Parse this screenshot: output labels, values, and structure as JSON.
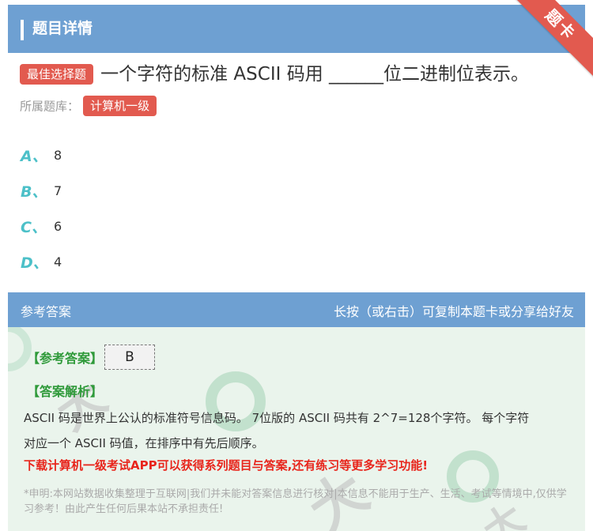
{
  "header": {
    "title": "题目详情",
    "ribbon_text": "题卡"
  },
  "question": {
    "type_tag": "最佳选择题",
    "text": "一个字符的标准 ASCII 码用 ______位二进制位表示。"
  },
  "bank": {
    "label": "所属题库：",
    "name": "计算机一级"
  },
  "options": [
    {
      "letter": "A、",
      "value": "8"
    },
    {
      "letter": "B、",
      "value": "7"
    },
    {
      "letter": "C、",
      "value": "6"
    },
    {
      "letter": "D、",
      "value": "4"
    }
  ],
  "answer_panel": {
    "heading": "参考答案",
    "hint": "长按（或右击）可复制本题卡或分享给好友",
    "answer_label": "【参考答案】",
    "answer_value": "B",
    "explain_label": "【答案解析】",
    "explain_line1": "ASCII 码是世界上公认的标准符号信息码。 7位版的 ASCII 码共有 2^7=128个字符。 每个字符",
    "explain_line2": "对应一个 ASCII 码值，在排序中有先后顺序。",
    "promo": "下载计算机一级考试APP可以获得系列题目与答案,还有练习等更多学习功能!",
    "disclaimer": "*申明:本网站数据收集整理于互联网|我们并未能对答案信息进行核对|本信息不能用于生产、生活、考试等情境中,仅供学习参考！由此产生任何后果本站不承担责任!"
  },
  "colors": {
    "header_blue": "#6ea0d2",
    "tag_red": "#e25a4f",
    "option_teal": "#4cc0c8",
    "answer_green": "#2f9a3a",
    "promo_red": "#e8251c",
    "panel_bg": "#eaf4ec"
  }
}
